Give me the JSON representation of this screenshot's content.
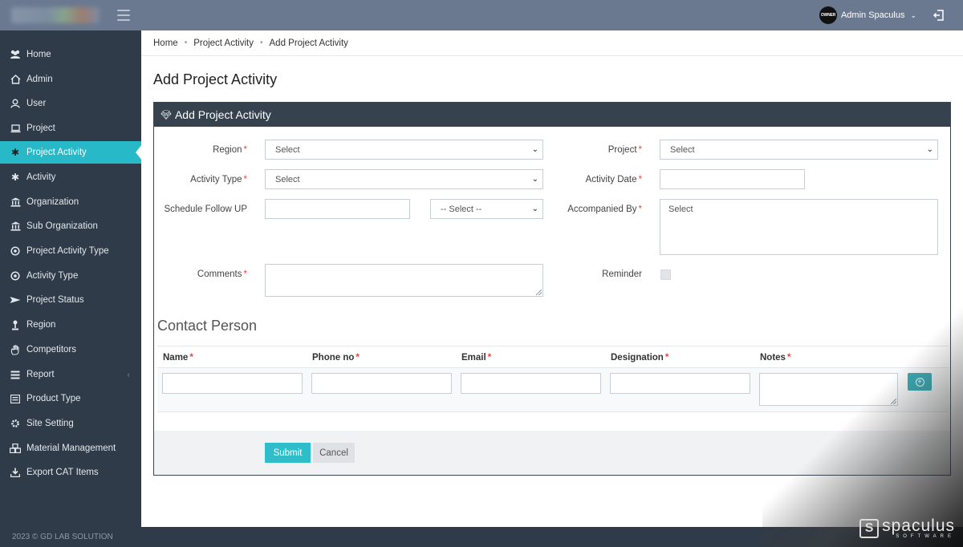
{
  "topbar": {
    "user_name": "Admin Spaculus",
    "avatar_text": "OWNER"
  },
  "sidebar": {
    "items": [
      {
        "label": "Home",
        "icon": "users-icon"
      },
      {
        "label": "Admin",
        "icon": "home-icon"
      },
      {
        "label": "User",
        "icon": "user-icon"
      },
      {
        "label": "Project",
        "icon": "laptop-icon"
      },
      {
        "label": "Project Activity",
        "icon": "asterisk-icon",
        "active": true
      },
      {
        "label": "Activity",
        "icon": "asterisk-icon"
      },
      {
        "label": "Organization",
        "icon": "bank-icon"
      },
      {
        "label": "Sub Organization",
        "icon": "bank-icon"
      },
      {
        "label": "Project Activity Type",
        "icon": "target-icon"
      },
      {
        "label": "Activity Type",
        "icon": "target-icon"
      },
      {
        "label": "Project Status",
        "icon": "send-icon"
      },
      {
        "label": "Region",
        "icon": "pin-icon"
      },
      {
        "label": "Competitors",
        "icon": "hand-icon"
      },
      {
        "label": "Report",
        "icon": "list-icon",
        "expandable": true
      },
      {
        "label": "Product Type",
        "icon": "list-alt-icon"
      },
      {
        "label": "Site Setting",
        "icon": "gear-icon"
      },
      {
        "label": "Material Management",
        "icon": "cubes-icon"
      },
      {
        "label": "Export CAT Items",
        "icon": "download-icon"
      }
    ]
  },
  "footer": {
    "copyright": "2023 © GD LAB SOLUTION"
  },
  "breadcrumb": [
    "Home",
    "Project Activity",
    "Add Project Activity"
  ],
  "page_title": "Add Project Activity",
  "card_title": "Add Project Activity",
  "form": {
    "region_label": "Region",
    "region_value": "Select",
    "project_label": "Project",
    "project_value": "Select",
    "activity_type_label": "Activity Type",
    "activity_type_value": "Select",
    "activity_date_label": "Activity Date",
    "activity_date_value": "",
    "schedule_label": "Schedule Follow UP",
    "schedule_value": "",
    "schedule_select_value": "-- Select --",
    "accompanied_label": "Accompanied By",
    "accompanied_value": "Select",
    "comments_label": "Comments",
    "comments_value": "",
    "reminder_label": "Reminder",
    "reminder_checked": false,
    "required_mark": "*"
  },
  "contact": {
    "title": "Contact Person",
    "columns": [
      "Name",
      "Phone no",
      "Email",
      "Designation",
      "Notes"
    ],
    "row": {
      "name": "",
      "phone": "",
      "email": "",
      "designation": "",
      "notes": ""
    }
  },
  "buttons": {
    "submit": "Submit",
    "cancel": "Cancel"
  },
  "watermark": {
    "brand": "spaculus",
    "tagline": "SOFTWARE",
    "logo_letter": "S"
  },
  "colors": {
    "accent": "#28b9c8",
    "sidebar": "#2f3b48",
    "topbar": "#6a7990",
    "card_header": "#37424f",
    "required": "#e04848"
  }
}
